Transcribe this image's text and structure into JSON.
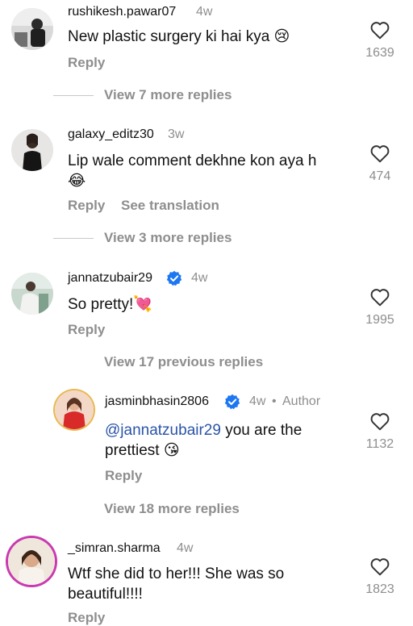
{
  "comments": [
    {
      "username": "rushikesh.pawar07",
      "time": "4w",
      "text": "New plastic surgery ki hai kya",
      "emoji": "😢",
      "reply_label": "Reply",
      "likes": "1639",
      "view_replies": "View 7 more replies"
    },
    {
      "username": "galaxy_editz30",
      "time": "3w",
      "text": "Lip wale comment dekhne kon aya h",
      "emoji": "😂",
      "reply_label": "Reply",
      "translation_label": "See translation",
      "likes": "474",
      "view_replies": "View 3 more replies"
    },
    {
      "username": "jannatzubair29",
      "time": "4w",
      "text": "So pretty!",
      "emoji": "💘",
      "reply_label": "Reply",
      "likes": "1995",
      "view_previous": "View 17 previous replies",
      "reply": {
        "username": "jasminbhasin2806",
        "time": "4w",
        "separator": "•",
        "author_label": "Author",
        "mention": "@jannatzubair29",
        "text": " you are the",
        "text2": "prettiest",
        "emoji": "😘",
        "reply_label": "Reply",
        "likes": "1132"
      },
      "view_replies": "View 18 more replies"
    },
    {
      "username": "_simran.sharma",
      "time": "4w",
      "text": "Wtf she did to her!!! She was so",
      "text2": "beautiful!!!!",
      "reply_label": "Reply",
      "likes": "1823"
    }
  ]
}
